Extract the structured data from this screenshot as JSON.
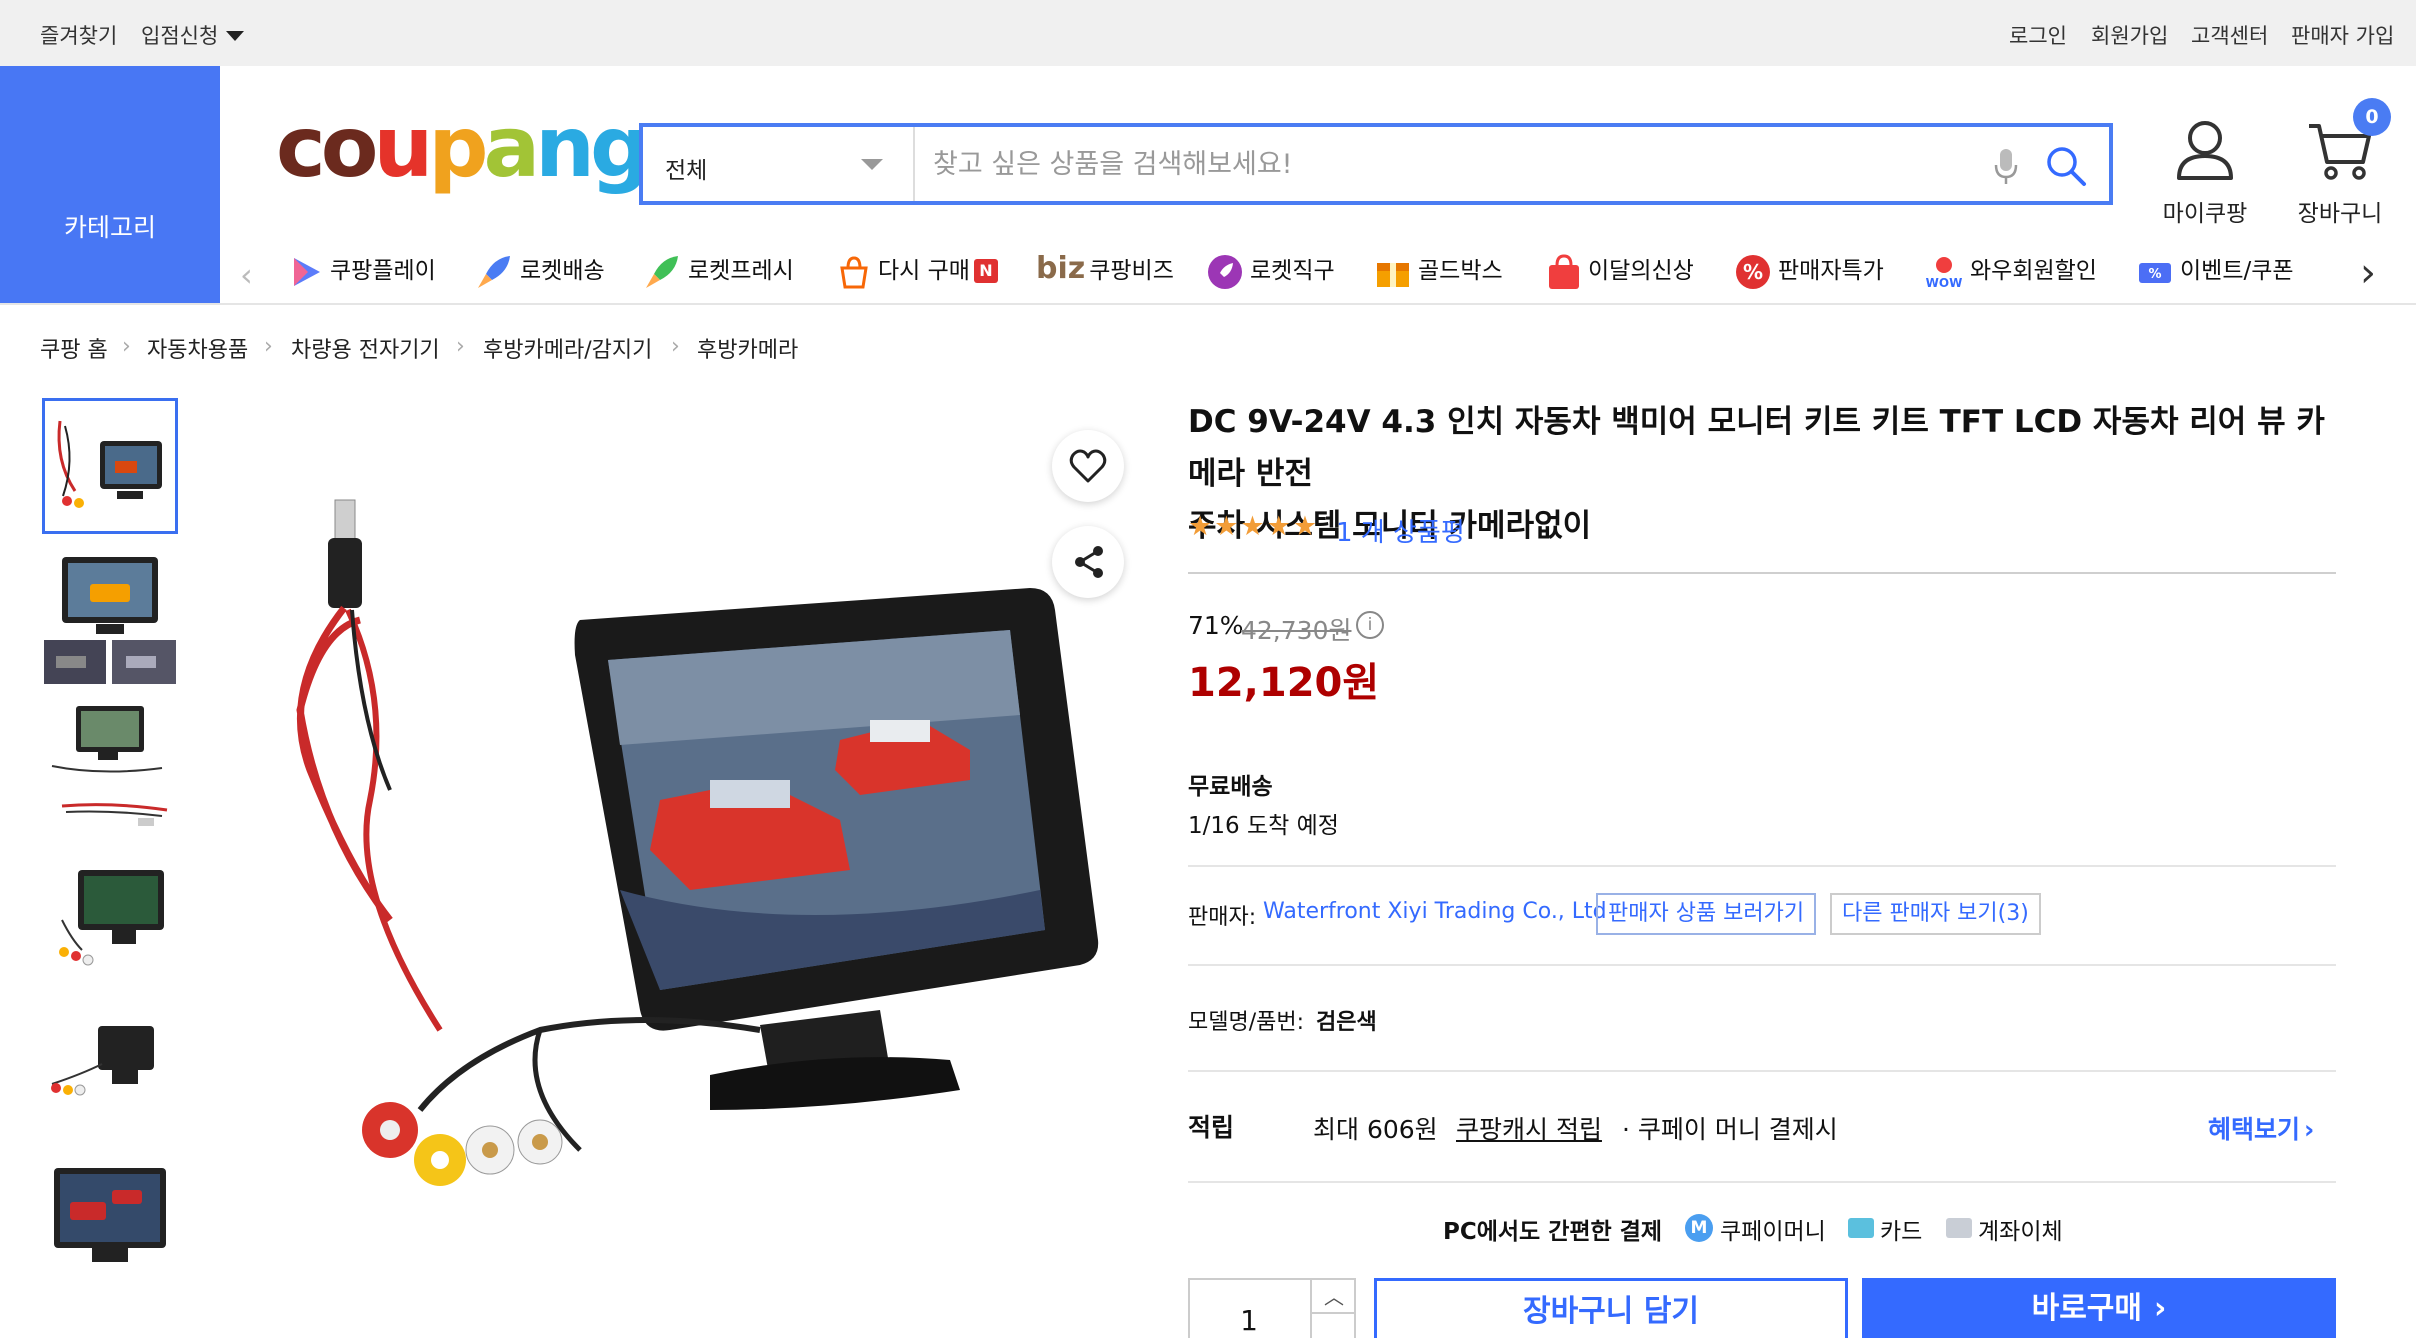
{
  "topbar": {
    "favorites": "즐겨찾기",
    "store_apply": "입점신청",
    "login": "로그인",
    "signup": "회원가입",
    "customer_center": "고객센터",
    "seller_signup": "판매자 가입"
  },
  "header": {
    "category_label": "카테고리",
    "logo": "coupang",
    "search": {
      "category": "전체",
      "placeholder": "찾고 싶은 상품을 검색해보세요!"
    },
    "mycoupang": "마이쿠팡",
    "cart": "장바구니",
    "cart_count": "0"
  },
  "category_strip": [
    {
      "label": "쿠팡플레이",
      "icon": "play-icon"
    },
    {
      "label": "로켓배송",
      "icon": "rocket-icon"
    },
    {
      "label": "로켓프레시",
      "icon": "rocket-fresh-icon"
    },
    {
      "label": "다시 구매",
      "icon": "rebuy-icon",
      "badge": "N"
    },
    {
      "label": "쿠팡비즈",
      "icon": "biz-icon",
      "prefix": "biz"
    },
    {
      "label": "로켓직구",
      "icon": "rocket-global-icon"
    },
    {
      "label": "골드박스",
      "icon": "goldbox-icon"
    },
    {
      "label": "이달의신상",
      "icon": "new-bag-icon"
    },
    {
      "label": "판매자특가",
      "icon": "percent-icon"
    },
    {
      "label": "와우회원할인",
      "icon": "wow-icon"
    },
    {
      "label": "이벤트/쿠폰",
      "icon": "coupon-icon"
    }
  ],
  "breadcrumb": [
    "쿠팡 홈",
    "자동차용품",
    "차량용 전자기기",
    "후방카메라/감지기",
    "후방카메라"
  ],
  "product": {
    "title_line1": "DC 9V-24V 4.3 인치 자동차 백미어 모니터 키트 키트 TFT LCD 자동차 리어 뷰 카메라 반전",
    "title_line2": "주차 시스템 모니터 카메라없이",
    "rating": 5,
    "review_text": "1 개 상품평",
    "discount": "71%",
    "original_price": "42,730원",
    "price": "12,120원",
    "shipping": "무료배송",
    "eta": "1/16 도착 예정",
    "seller_label": "판매자:",
    "seller_name": "Waterfront Xiyi Trading Co., Ltd",
    "seller_products_btn": "판매자 상품 보러가기",
    "other_sellers_btn": "다른 판매자 보기(3)",
    "model_label": "모델명/품번:",
    "model_value": "검은색",
    "points_label": "적립",
    "points_max": "최대 606원",
    "points_cash": "쿠팡캐시 적립",
    "points_pay": "· 쿠페이 머니 결제시",
    "benefit_link": "혜택보기",
    "pay_intro": "PC에서도 간편한 결제",
    "pay_money": "쿠페이머니",
    "pay_card": "카드",
    "pay_bank": "계좌이체",
    "quantity": "1",
    "add_to_cart": "장바구니 담기",
    "buy_now": "바로구매"
  },
  "colors": {
    "brand_blue": "#4877f4",
    "link_blue": "#346aff",
    "price_red": "#ae0000",
    "star": "#f29d38"
  }
}
